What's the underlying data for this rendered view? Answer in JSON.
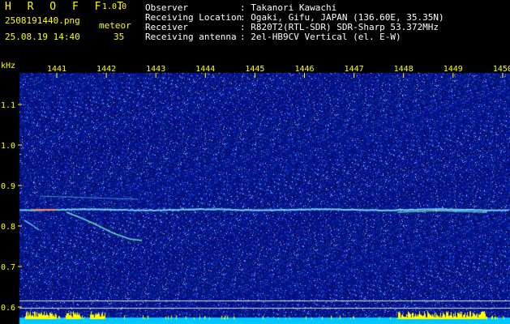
{
  "header": {
    "brand": "H R O F F T",
    "version": "1.0.0",
    "filename": "2508191440.png",
    "datetime": "25.08.19 14:40",
    "meteor_label": "meteor",
    "meteor_count": "35",
    "observer_label": "Observer",
    "observer_value": ": Takanori Kawachi",
    "location_label": "Receiving Location",
    "location_value": ": Ogaki, Gifu, JAPAN (136.60E, 35.35N)",
    "receiver_label": "Receiver",
    "receiver_value": ": R820T2(RTL-SDR) SDR-Sharp 53.372MHz",
    "antenna_label": "Receiving antenna",
    "antenna_value": ": 2el-HB9CV Vertical (el. E-W)"
  },
  "axis": {
    "unit": "kHz",
    "time_ticks": [
      "1441",
      "1442",
      "1443",
      "1444",
      "1445",
      "1446",
      "1447",
      "1448",
      "1449",
      "1450"
    ],
    "freq_ticks": [
      "1.1",
      "1.0",
      "0.9",
      "0.8",
      "0.7",
      "0.6"
    ]
  },
  "colors": {
    "background": "#000000",
    "noise_base": "#0a0f7a",
    "axis_text": "#ffff00",
    "header_text": "#ffffff",
    "histogram": "#ffff00",
    "baseline": "#00c8ff"
  }
}
